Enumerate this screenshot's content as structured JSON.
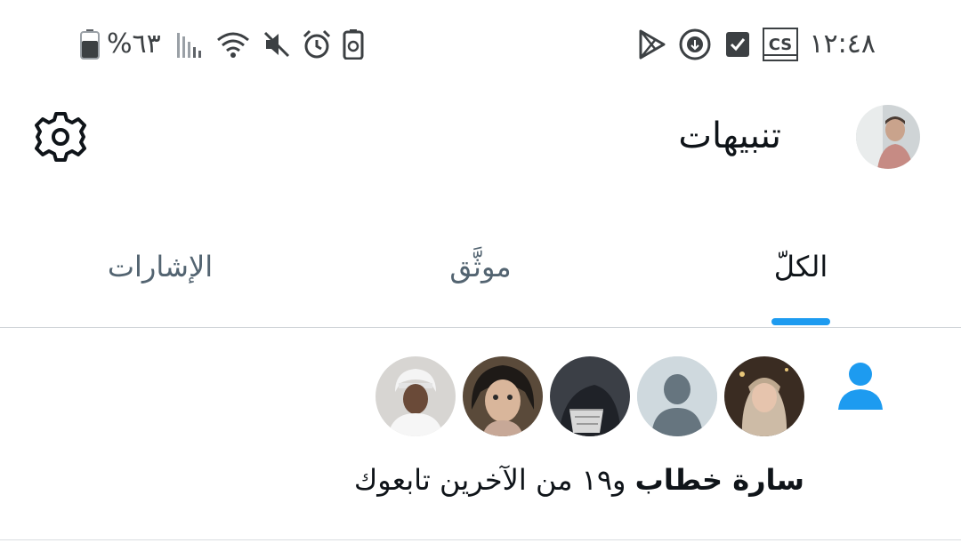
{
  "status_bar": {
    "time": "١٢:٤٨",
    "battery_text": "%٦٣",
    "battery_level": 0.63,
    "icons_right": [
      "play-store-icon",
      "download-circle-icon",
      "checkbox-icon",
      "cs-app-icon"
    ],
    "icons_left": [
      "battery-icon",
      "signal-icon",
      "wifi-icon",
      "mute-icon",
      "alarm-icon",
      "battery-saver-icon"
    ]
  },
  "header": {
    "title": "تنبيهات"
  },
  "tabs": [
    {
      "label": "الكلّ",
      "active": true
    },
    {
      "label": "موثَّق",
      "active": false
    },
    {
      "label": "الإشارات",
      "active": false
    }
  ],
  "notification": {
    "type": "follow",
    "actor_name": "سارة خطاب",
    "rest_text": "و١٩ من الآخرين تابعوك",
    "avatars": [
      "avatar-woman-hijab",
      "avatar-default",
      "avatar-hooded",
      "avatar-child",
      "avatar-man-headscarf"
    ]
  },
  "colors": {
    "accent": "#1d9bf0",
    "text_primary": "#0f1419",
    "text_secondary": "#536471"
  }
}
